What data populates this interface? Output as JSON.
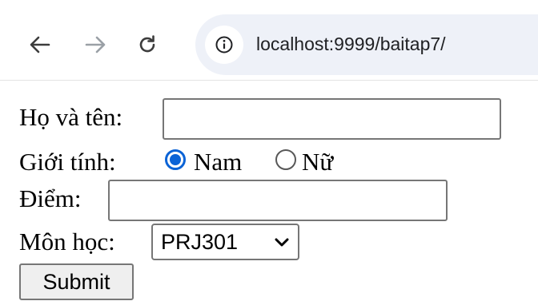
{
  "browser": {
    "back_icon": "arrow-left-icon",
    "forward_icon": "arrow-right-icon",
    "reload_icon": "reload-icon",
    "site_info_icon": "info-icon",
    "url": "localhost:9999/baitap7/"
  },
  "form": {
    "name_label": "Họ và tên:",
    "name_value": "",
    "gender_label": "Giới tính:",
    "gender_options": [
      {
        "label": "Nam",
        "checked": true
      },
      {
        "label": "Nữ",
        "checked": false
      }
    ],
    "score_label": "Điểm:",
    "score_value": "",
    "subject_label": "Môn học:",
    "subject_selected": "PRJ301",
    "submit_label": "Submit"
  },
  "colors": {
    "radio_accent": "#0b63d6",
    "omnibox_bg": "#eef1f8"
  }
}
